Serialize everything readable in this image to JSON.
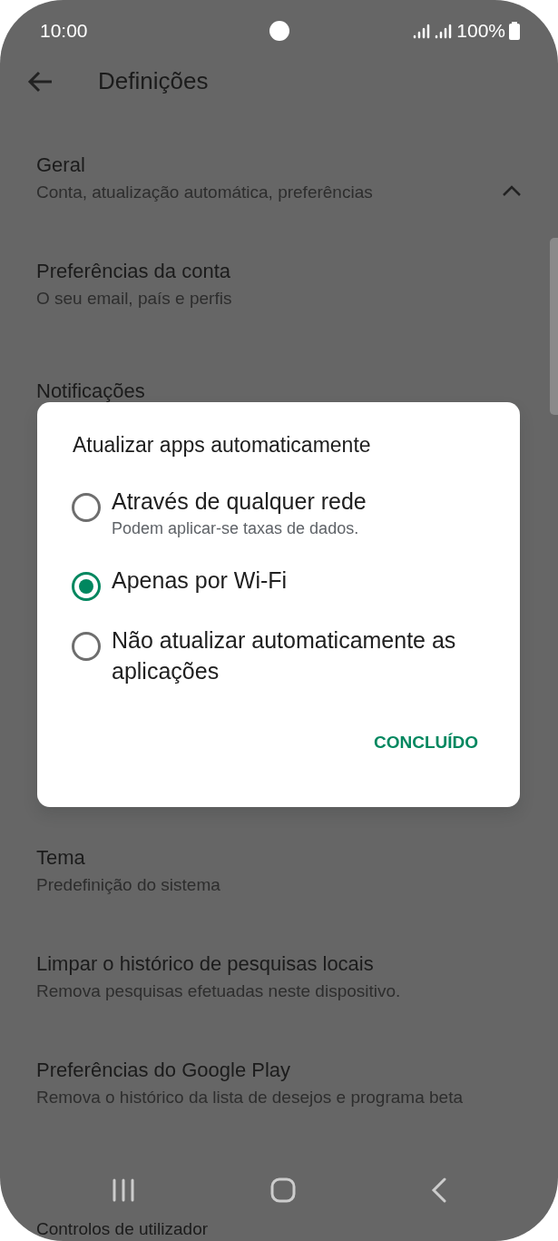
{
  "status_bar": {
    "time": "10:00",
    "battery": "100%"
  },
  "header": {
    "title": "Definições"
  },
  "settings": [
    {
      "title": "Geral",
      "subtitle": "Conta, atualização automática, preferências",
      "expanded": true
    },
    {
      "title": "Preferências da conta",
      "subtitle": "O seu email, país e perfis"
    },
    {
      "title": "Notificações"
    }
  ],
  "settings_below_dialog": [
    {
      "title": "Tema",
      "subtitle": "Predefinição do sistema"
    },
    {
      "title": "Limpar o histórico de pesquisas locais",
      "subtitle": "Remova pesquisas efetuadas neste dispositivo."
    },
    {
      "title": "Preferências do Google Play",
      "subtitle": "Remova o histórico da lista de desejos e programa beta"
    },
    {
      "title": "Controlos de utilizador"
    }
  ],
  "dialog": {
    "title": "Atualizar apps automaticamente",
    "options": [
      {
        "label": "Através de qualquer rede",
        "hint": "Podem aplicar-se taxas de dados.",
        "selected": false
      },
      {
        "label": "Apenas por Wi-Fi",
        "selected": true
      },
      {
        "label": "Não atualizar automaticamente as aplicações",
        "selected": false
      }
    ],
    "button": "CONCLUÍDO"
  }
}
